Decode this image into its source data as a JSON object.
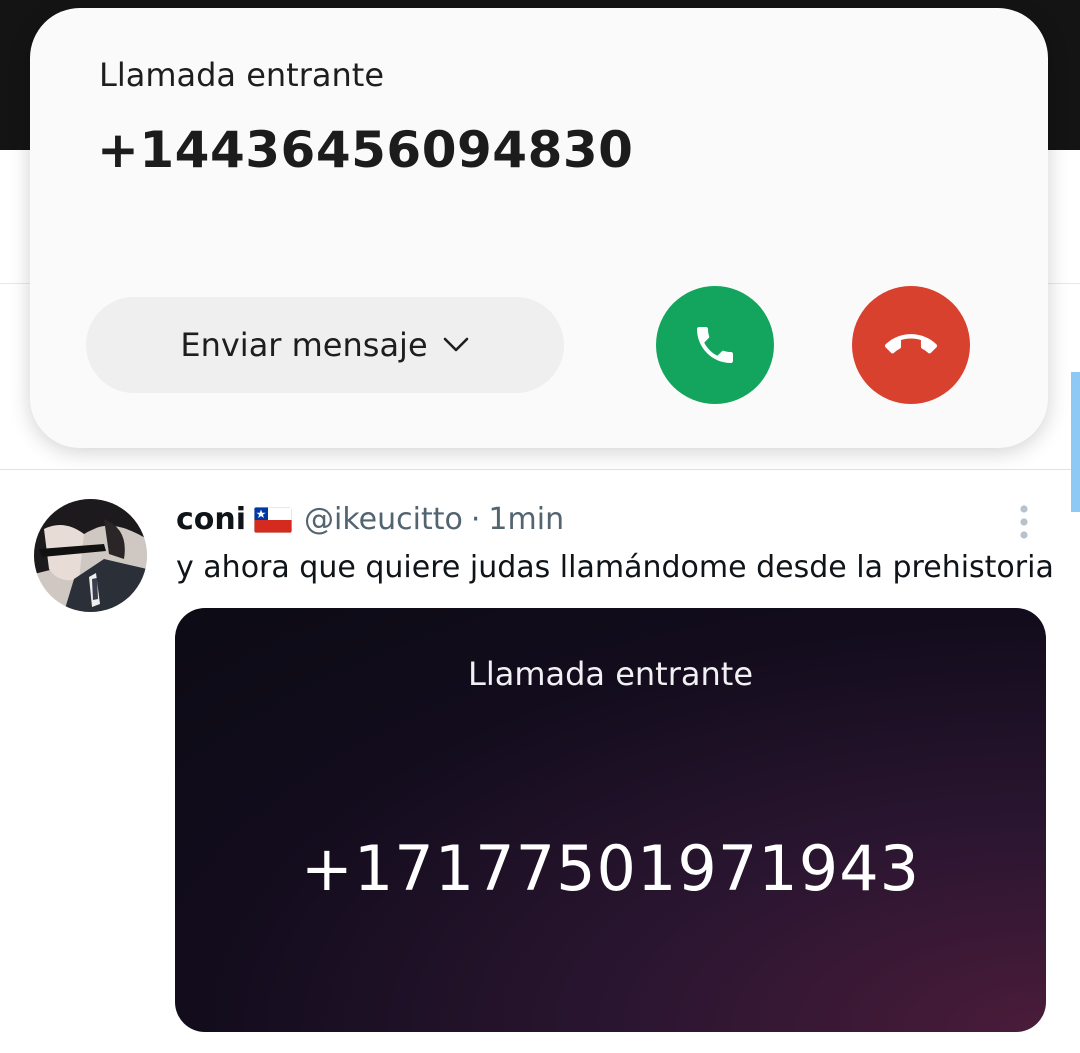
{
  "incoming_call": {
    "title": "Llamada entrante",
    "number": "+14436456094830",
    "message_button_label": "Enviar mensaje",
    "accept_icon": "phone-icon",
    "decline_icon": "phone-hangup-icon",
    "accept_color": "#13a55d",
    "decline_color": "#d9412f"
  },
  "tweet": {
    "author_name": "coni",
    "flag": "chile-flag-icon",
    "handle": "@ikeucitto",
    "separator": "·",
    "time": "1min",
    "text": "y ahora que quiere judas llamándome desde la prehistoria",
    "media": {
      "title": "Llamada entrante",
      "number": "+17177501971943"
    }
  }
}
